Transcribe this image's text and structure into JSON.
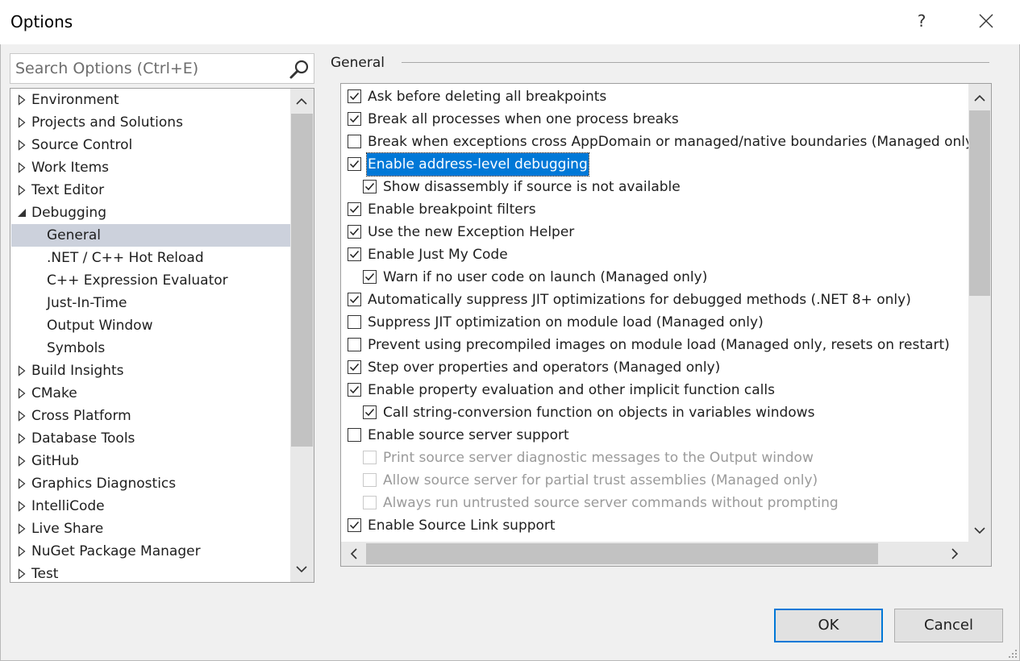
{
  "window": {
    "title": "Options",
    "help_glyph": "?",
    "close_glyph": "✕"
  },
  "search": {
    "placeholder": "Search Options (Ctrl+E)",
    "icon": "search-icon"
  },
  "tree": {
    "items": [
      {
        "label": "Environment",
        "level": 0,
        "state": "collapsed"
      },
      {
        "label": "Projects and Solutions",
        "level": 0,
        "state": "collapsed"
      },
      {
        "label": "Source Control",
        "level": 0,
        "state": "collapsed"
      },
      {
        "label": "Work Items",
        "level": 0,
        "state": "collapsed"
      },
      {
        "label": "Text Editor",
        "level": 0,
        "state": "collapsed"
      },
      {
        "label": "Debugging",
        "level": 0,
        "state": "expanded"
      },
      {
        "label": "General",
        "level": 1,
        "state": "leaf",
        "selected": true
      },
      {
        "label": ".NET / C++ Hot Reload",
        "level": 1,
        "state": "leaf"
      },
      {
        "label": "C++ Expression Evaluator",
        "level": 1,
        "state": "leaf"
      },
      {
        "label": "Just-In-Time",
        "level": 1,
        "state": "leaf"
      },
      {
        "label": "Output Window",
        "level": 1,
        "state": "leaf"
      },
      {
        "label": "Symbols",
        "level": 1,
        "state": "leaf"
      },
      {
        "label": "Build Insights",
        "level": 0,
        "state": "collapsed"
      },
      {
        "label": "CMake",
        "level": 0,
        "state": "collapsed"
      },
      {
        "label": "Cross Platform",
        "level": 0,
        "state": "collapsed"
      },
      {
        "label": "Database Tools",
        "level": 0,
        "state": "collapsed"
      },
      {
        "label": "GitHub",
        "level": 0,
        "state": "collapsed"
      },
      {
        "label": "Graphics Diagnostics",
        "level": 0,
        "state": "collapsed"
      },
      {
        "label": "IntelliCode",
        "level": 0,
        "state": "collapsed"
      },
      {
        "label": "Live Share",
        "level": 0,
        "state": "collapsed"
      },
      {
        "label": "NuGet Package Manager",
        "level": 0,
        "state": "collapsed"
      },
      {
        "label": "Test",
        "level": 0,
        "state": "collapsed"
      }
    ]
  },
  "general": {
    "group_title": "General",
    "options": [
      {
        "label": "Ask before deleting all breakpoints",
        "checked": true,
        "level": 0
      },
      {
        "label": "Break all processes when one process breaks",
        "checked": true,
        "level": 0
      },
      {
        "label": "Break when exceptions cross AppDomain or managed/native boundaries (Managed only)",
        "checked": false,
        "level": 0
      },
      {
        "label": "Enable address-level debugging",
        "checked": true,
        "level": 0,
        "focused": true
      },
      {
        "label": "Show disassembly if source is not available",
        "checked": true,
        "level": 1
      },
      {
        "label": "Enable breakpoint filters",
        "checked": true,
        "level": 0
      },
      {
        "label": "Use the new Exception Helper",
        "checked": true,
        "level": 0
      },
      {
        "label": "Enable Just My Code",
        "checked": true,
        "level": 0
      },
      {
        "label": "Warn if no user code on launch (Managed only)",
        "checked": true,
        "level": 1
      },
      {
        "label": "Automatically suppress JIT optimizations for debugged methods (.NET 8+ only)",
        "checked": true,
        "level": 0
      },
      {
        "label": "Suppress JIT optimization on module load (Managed only)",
        "checked": false,
        "level": 0
      },
      {
        "label": "Prevent using precompiled images on module load (Managed only, resets on restart)",
        "checked": false,
        "level": 0
      },
      {
        "label": "Step over properties and operators (Managed only)",
        "checked": true,
        "level": 0
      },
      {
        "label": "Enable property evaluation and other implicit function calls",
        "checked": true,
        "level": 0
      },
      {
        "label": "Call string-conversion function on objects in variables windows",
        "checked": true,
        "level": 1
      },
      {
        "label": "Enable source server support",
        "checked": false,
        "level": 0
      },
      {
        "label": "Print source server diagnostic messages to the Output window",
        "checked": false,
        "level": 1,
        "disabled": true
      },
      {
        "label": "Allow source server for partial trust assemblies (Managed only)",
        "checked": false,
        "level": 1,
        "disabled": true
      },
      {
        "label": "Always run untrusted source server commands without prompting",
        "checked": false,
        "level": 1,
        "disabled": true
      },
      {
        "label": "Enable Source Link support",
        "checked": true,
        "level": 0
      }
    ]
  },
  "buttons": {
    "ok": "OK",
    "cancel": "Cancel"
  },
  "colors": {
    "selection": "#0078d7",
    "tree_selected": "#ccd1dc"
  }
}
